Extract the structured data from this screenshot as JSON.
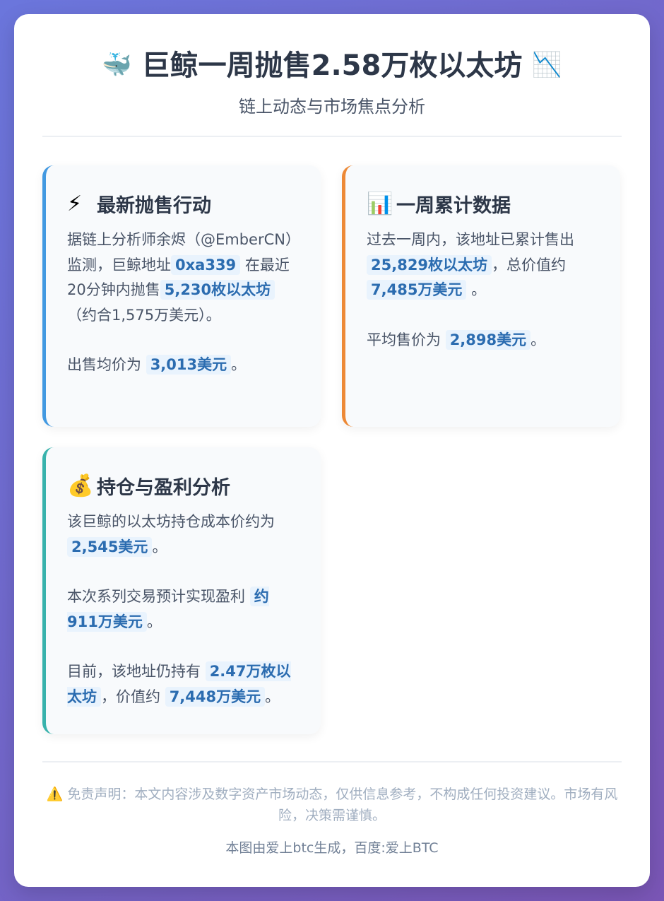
{
  "header": {
    "emoji_left": "🐳",
    "title": "巨鲸一周抛售2.58万枚以太坊",
    "emoji_right": "📉",
    "subtitle": "链上动态与市场焦点分析"
  },
  "cards": {
    "sale": {
      "icon": "⚡",
      "title": "最新抛售行动",
      "p1_a": "据链上分析师余烬（@EmberCN）监测，巨鲸地址",
      "p1_addr": "0xa339",
      "p1_b": "在最近20分钟内抛售",
      "p1_amount": "5,230枚以太坊",
      "p1_c": "（约合1,575万美元）。",
      "p2_a": "出售均价为",
      "p2_price": "3,013美元",
      "p2_b": "。"
    },
    "weekly": {
      "icon": "📊",
      "title": "一周累计数据",
      "p1_a": "过去一周内，该地址已累计售出",
      "p1_amount": "25,829枚以太坊",
      "p1_b": "，总价值约",
      "p1_value": "7,485万美元",
      "p1_c": "。",
      "p2_a": "平均售价为",
      "p2_price": "2,898美元",
      "p2_b": "。"
    },
    "profit": {
      "icon": "💰",
      "title": "持仓与盈利分析",
      "p1_a": "该巨鲸的以太坊持仓成本价约为",
      "p1_cost": "2,545美元",
      "p1_b": "。",
      "p2_a": "本次系列交易预计实现盈利",
      "p2_profit": "约911万美元",
      "p2_b": "。",
      "p3_a": "目前，该地址仍持有",
      "p3_hold": "2.47万枚以太坊",
      "p3_b": "，价值约",
      "p3_value": "7,448万美元",
      "p3_c": "。"
    }
  },
  "footer": {
    "warning_icon": "⚠️",
    "disclaimer": "免责声明：本文内容涉及数字资产市场动态，仅供信息参考，不构成任何投资建议。市场有风险，决策需谨慎。",
    "credit": "本图由爱上btc生成，百度:爱上BTC"
  },
  "colors": {
    "accent_blue": "#4299e1",
    "accent_orange": "#ed8936",
    "accent_teal": "#38b2ac",
    "highlight_text": "#2b6cb0",
    "highlight_bg": "#e9f3fd"
  }
}
